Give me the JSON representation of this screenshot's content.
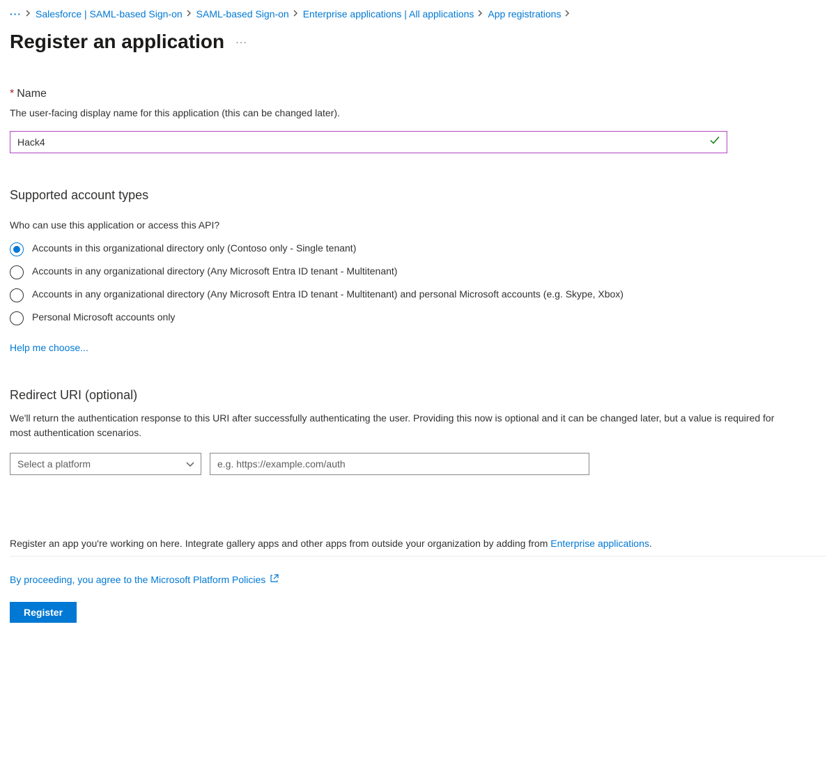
{
  "breadcrumb": {
    "items": [
      "Salesforce | SAML-based Sign-on",
      "SAML-based Sign-on",
      "Enterprise applications | All applications",
      "App registrations"
    ]
  },
  "header": {
    "title": "Register an application"
  },
  "name_section": {
    "label": "Name",
    "description": "The user-facing display name for this application (this can be changed later).",
    "value": "Hack4"
  },
  "account_types": {
    "title": "Supported account types",
    "question": "Who can use this application or access this API?",
    "options": [
      "Accounts in this organizational directory only (Contoso only - Single tenant)",
      "Accounts in any organizational directory (Any Microsoft Entra ID tenant - Multitenant)",
      "Accounts in any organizational directory (Any Microsoft Entra ID tenant - Multitenant) and personal Microsoft accounts (e.g. Skype, Xbox)",
      "Personal Microsoft accounts only"
    ],
    "help_link": "Help me choose..."
  },
  "redirect": {
    "title": "Redirect URI (optional)",
    "description": "We'll return the authentication response to this URI after successfully authenticating the user. Providing this now is optional and it can be changed later, but a value is required for most authentication scenarios.",
    "platform_placeholder": "Select a platform",
    "uri_placeholder": "e.g. https://example.com/auth"
  },
  "footer": {
    "note_prefix": "Register an app you're working on here. Integrate gallery apps and other apps from outside your organization by adding from ",
    "note_link": "Enterprise applications",
    "note_suffix": ".",
    "policy_text": "By proceeding, you agree to the Microsoft Platform Policies",
    "register_label": "Register"
  }
}
